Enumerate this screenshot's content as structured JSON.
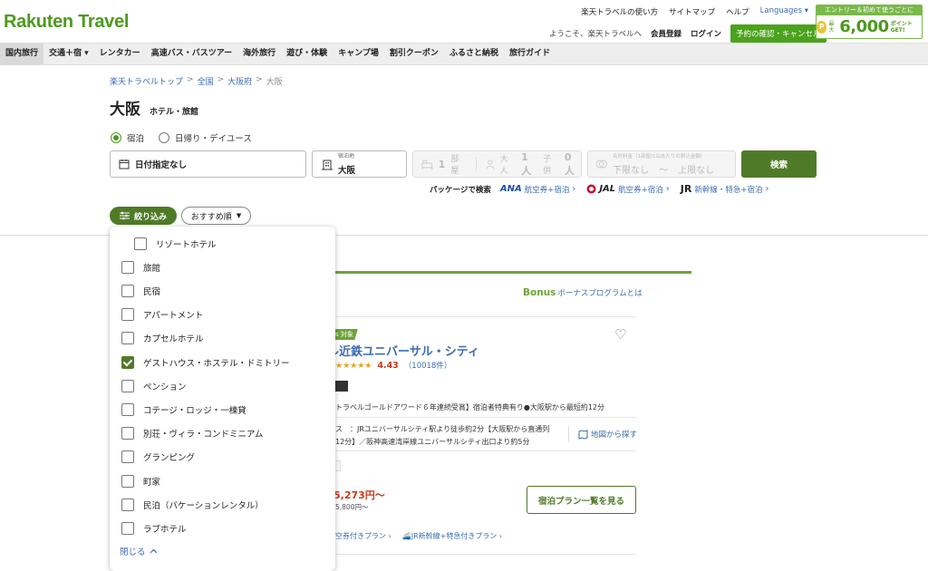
{
  "header": {
    "logo": "Rakuten Travel",
    "links": [
      "楽天トラベルの使い方",
      "サイトマップ",
      "ヘルプ",
      "Languages ▾"
    ],
    "welcome": "ようこそ、楽天トラベルへ",
    "register": "会員登録",
    "login": "ログイン",
    "reservation": "予約の確認・キャンセル",
    "promo": {
      "top": "エントリー＆初めて使うごとに",
      "small": "最大",
      "amount": "6,000",
      "points": "ポイント GET!"
    }
  },
  "nav": [
    {
      "label": "国内旅行",
      "active": true
    },
    {
      "label": "交通＋宿 ▾",
      "active": false
    },
    {
      "label": "レンタカー",
      "active": false
    },
    {
      "label": "高速バス・バスツアー",
      "active": false
    },
    {
      "label": "海外旅行",
      "active": false
    },
    {
      "label": "遊び・体験",
      "active": false
    },
    {
      "label": "キャンプ場",
      "active": false
    },
    {
      "label": "割引クーポン",
      "active": false
    },
    {
      "label": "ふるさと納税",
      "active": false
    },
    {
      "label": "旅行ガイド",
      "active": false
    }
  ],
  "breadcrumb": [
    "楽天トラベルトップ",
    "全国",
    "大阪府",
    "大阪"
  ],
  "title": {
    "main": "大阪",
    "sub": "ホテル・旅館"
  },
  "stay_type": {
    "option1": "宿泊",
    "option2": "日帰り・デイユース",
    "selected": "宿泊"
  },
  "search": {
    "date": "日付指定なし",
    "dest_label": "宿泊地",
    "dest_value": "大阪",
    "rooms": "1",
    "rooms_unit": "部屋",
    "adults_label": "大人",
    "adults": "1人",
    "children_label": "子供",
    "children": "0人",
    "price_label": "合計料金（1部屋/1泊あたりの税込金額）",
    "price_min": "下限なし",
    "price_sep": "〜",
    "price_max": "上限なし",
    "button": "検索"
  },
  "packages": {
    "label": "パッケージで検索",
    "ana_logo": "ANA",
    "ana_text": "航空券+宿泊",
    "jal_logo": "JAL",
    "jal_text": "航空券+宿泊",
    "jr_logo": "JR",
    "jr_text": "新幹線・特急+宿泊"
  },
  "filter_button": "絞り込み",
  "sort_button": "おすすめ順",
  "dropdown": {
    "options": [
      {
        "label": "リゾートホテル",
        "checked": false,
        "sub": true
      },
      {
        "label": "旅館",
        "checked": false,
        "sub": false
      },
      {
        "label": "民宿",
        "checked": false,
        "sub": false
      },
      {
        "label": "アパートメント",
        "checked": false,
        "sub": false
      },
      {
        "label": "カプセルホテル",
        "checked": false,
        "sub": false
      },
      {
        "label": "ゲストハウス・ホステル・ドミトリー",
        "checked": true,
        "sub": false
      },
      {
        "label": "ペンション",
        "checked": false,
        "sub": false
      },
      {
        "label": "コテージ・ロッジ・一棟貸",
        "checked": false,
        "sub": false
      },
      {
        "label": "別荘・ヴィラ・コンドミニアム",
        "checked": false,
        "sub": false
      },
      {
        "label": "グランピング",
        "checked": false,
        "sub": false
      },
      {
        "label": "町家",
        "checked": false,
        "sub": false
      },
      {
        "label": "民泊（バケーションレンタル）",
        "checked": false,
        "sub": false
      },
      {
        "label": "ラブホテル",
        "checked": false,
        "sub": false
      }
    ],
    "close": "閉じる"
  },
  "result": {
    "bonus_brand": "Bonus",
    "bonus_text": "ボーナスプログラムとは",
    "tag": "s 対象",
    "hotel_name": "ル近鉄ユニバーサル・シティ",
    "stars": "★★★★★",
    "score": "4.43",
    "reviews": "（10018件）",
    "description": "トラベルゴールドアワード６年連続受賞】宿泊者特典有り●大阪駅から最短約12分",
    "access1": "ス　：JRユニバーサルシティ駅より徒歩約2分【大阪駅から直通列",
    "access2": "12分】／阪神高速湾岸線ユニバーサルシティ出口より約5分",
    "map_link": "地図から探す",
    "price": "5,273円〜",
    "price_sub": "5,800円〜",
    "plan_button": "宿泊プラン一覧を見る",
    "link1": "空券付きプラン",
    "link2": "JR新幹線+特急付きプラン"
  }
}
